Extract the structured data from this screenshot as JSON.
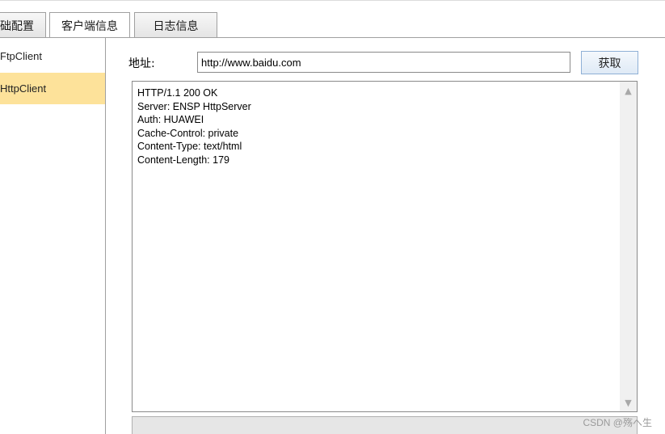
{
  "tabs": [
    {
      "label": "础配置"
    },
    {
      "label": "客户端信息"
    },
    {
      "label": "日志信息"
    }
  ],
  "sidebar": {
    "items": [
      {
        "label": "FtpClient"
      },
      {
        "label": "HttpClient"
      }
    ]
  },
  "form": {
    "address_label": "地址:",
    "address_value": "http://www.baidu.com",
    "fetch_label": "获取"
  },
  "response": {
    "text": "HTTP/1.1 200 OK\nServer: ENSP HttpServer\nAuth: HUAWEI\nCache-Control: private\nContent-Type: text/html\nContent-Length: 179"
  },
  "scrollbar": {
    "up_icon": "▲",
    "down_icon": "▼"
  },
  "watermark": "CSDN @殇へ生",
  "colors": {
    "selected_item": "#fde29a",
    "button_border": "#8fb0d6"
  }
}
